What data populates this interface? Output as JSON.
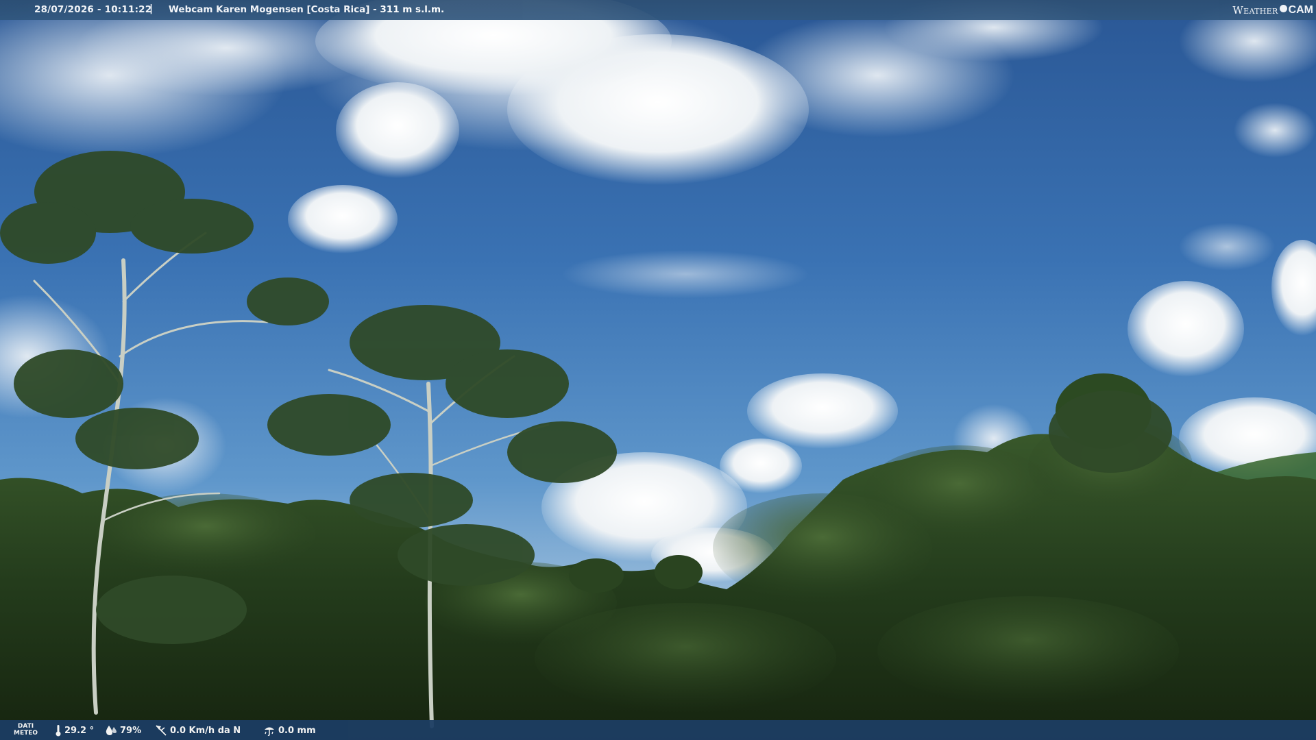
{
  "topbar": {
    "datetime": "28/07/2026 - 10:11:22",
    "separator": "|",
    "title": "Webcam Karen Mogensen [Costa Rica]  - 311 m s.l.m."
  },
  "logo": {
    "weather": "Weather",
    "cam": "CAM"
  },
  "weather": {
    "label_line1": "DATI",
    "label_line2": "METEO",
    "temperature": "29.2 °",
    "humidity": "79%",
    "wind": "0.0 Km/h da N",
    "rain": "0.0 mm"
  },
  "colors": {
    "bar_top": "#30567d",
    "bar_bottom": "#1c3d63",
    "sky_top": "#2e5d9a",
    "sky_bottom": "#8ab4d8",
    "forest": "#27411f"
  },
  "icons": [
    "thermometer-icon",
    "humidity-icon",
    "wind-icon",
    "rain-icon"
  ]
}
